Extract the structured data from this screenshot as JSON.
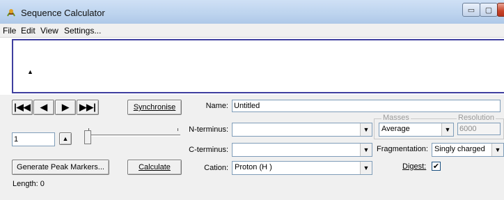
{
  "window": {
    "title": "Sequence Calculator",
    "minimize_symbol": "▭",
    "maximize_symbol": "▢",
    "close_symbol": "X"
  },
  "menu": [
    "File",
    "Edit",
    "View",
    "Settings..."
  ],
  "navigation": {
    "first": "|◀◀",
    "prev": "◀",
    "next": "▶",
    "last": "▶▶|",
    "synchronise_label": "Synchronise"
  },
  "position": {
    "value": "1",
    "spin_symbol": "▲"
  },
  "actions": {
    "generate_label": "Generate Peak Markers...",
    "calculate_label": "Calculate"
  },
  "status": {
    "length": "Length: 0"
  },
  "form": {
    "name_label": "Name:",
    "name_value": "Untitled",
    "nterm_label": "N-terminus:",
    "nterm_value": "",
    "cterm_label": "C-terminus:",
    "cterm_value": "",
    "cation_label": "Cation:",
    "cation_value": "Proton (H )"
  },
  "masses": {
    "legend": "Masses",
    "value": "Average",
    "resolution_label": "Resolution",
    "resolution_value": "6000"
  },
  "fragmentation": {
    "label": "Fragmentation:",
    "value": "Singly charged"
  },
  "digest": {
    "label": "Digest:",
    "checked": true
  },
  "colors": {
    "display_border": "#3f3f9f",
    "panel_bg": "#f0f0f0"
  }
}
